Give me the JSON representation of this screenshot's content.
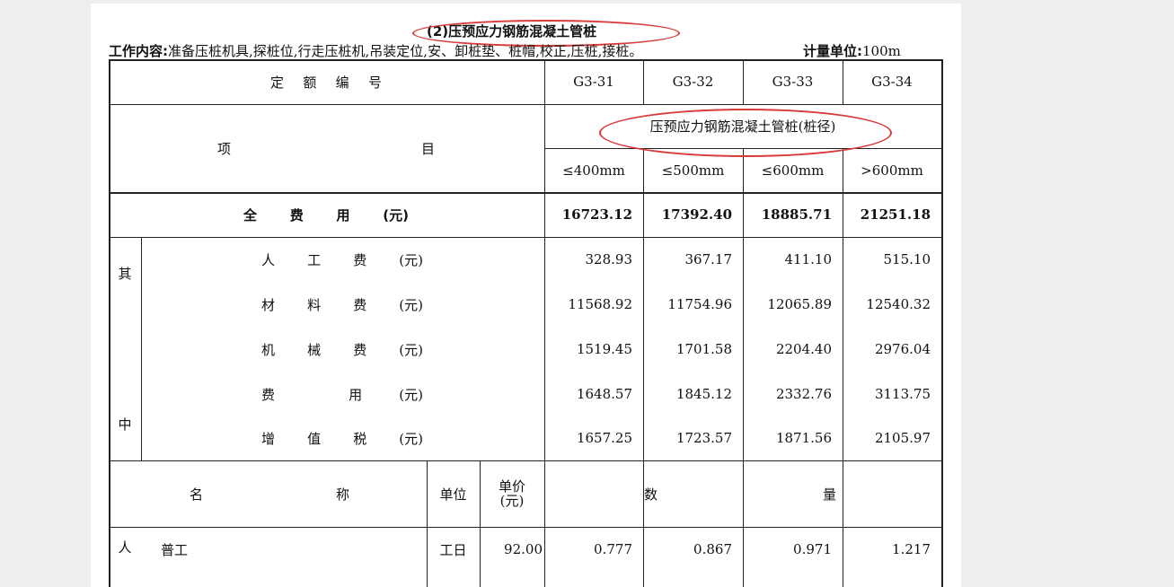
{
  "title": "(2)压预应力钢筋混凝土管桩",
  "work_content": {
    "label": "工作内容:",
    "text": "准备压桩机具,探桩位,行走压桩机,吊装定位,安、卸桩垫、桩帽,校正,压桩,接桩。"
  },
  "unit": {
    "label": "计量单位:",
    "value": "100m"
  },
  "header": {
    "quota_code_label": [
      "定",
      "额",
      "编",
      "号"
    ],
    "codes": [
      "G3-31",
      "G3-32",
      "G3-33",
      "G3-34"
    ],
    "item_label": [
      "项",
      "目"
    ],
    "group_label": "压预应力钢筋混凝土管桩(桩径)",
    "diameters": [
      "≤400mm",
      "≤500mm",
      "≤600mm",
      ">600mm"
    ]
  },
  "total": {
    "label": [
      "全",
      "费",
      "用",
      "(元)"
    ],
    "values": [
      "16723.12",
      "17392.40",
      "18885.71",
      "21251.18"
    ]
  },
  "breakdown": {
    "side_label": [
      "其",
      "中"
    ],
    "rows": [
      {
        "label": [
          "人",
          "工",
          "费",
          "(元)"
        ],
        "values": [
          "328.93",
          "367.17",
          "411.10",
          "515.10"
        ]
      },
      {
        "label": [
          "材",
          "料",
          "费",
          "(元)"
        ],
        "values": [
          "11568.92",
          "11754.96",
          "12065.89",
          "12540.32"
        ]
      },
      {
        "label": [
          "机",
          "械",
          "费",
          "(元)"
        ],
        "values": [
          "1519.45",
          "1701.58",
          "2204.40",
          "2976.04"
        ]
      },
      {
        "label": [
          "费",
          "",
          "用",
          "(元)"
        ],
        "values": [
          "1648.57",
          "1845.12",
          "2332.76",
          "3113.75"
        ]
      },
      {
        "label": [
          "增",
          "值",
          "税",
          "(元)"
        ],
        "values": [
          "1657.25",
          "1723.57",
          "1871.56",
          "2105.97"
        ]
      }
    ]
  },
  "resource_header": {
    "name": [
      "名",
      "称"
    ],
    "unit": "单位",
    "price_line1": "单价",
    "price_line2": "(元)",
    "quantity": [
      "数",
      "量"
    ]
  },
  "resources": [
    {
      "group": "人",
      "name": "普工",
      "unit": "工日",
      "price": "92.00",
      "values": [
        "0.777",
        "0.867",
        "0.971",
        "1.217"
      ]
    }
  ]
}
